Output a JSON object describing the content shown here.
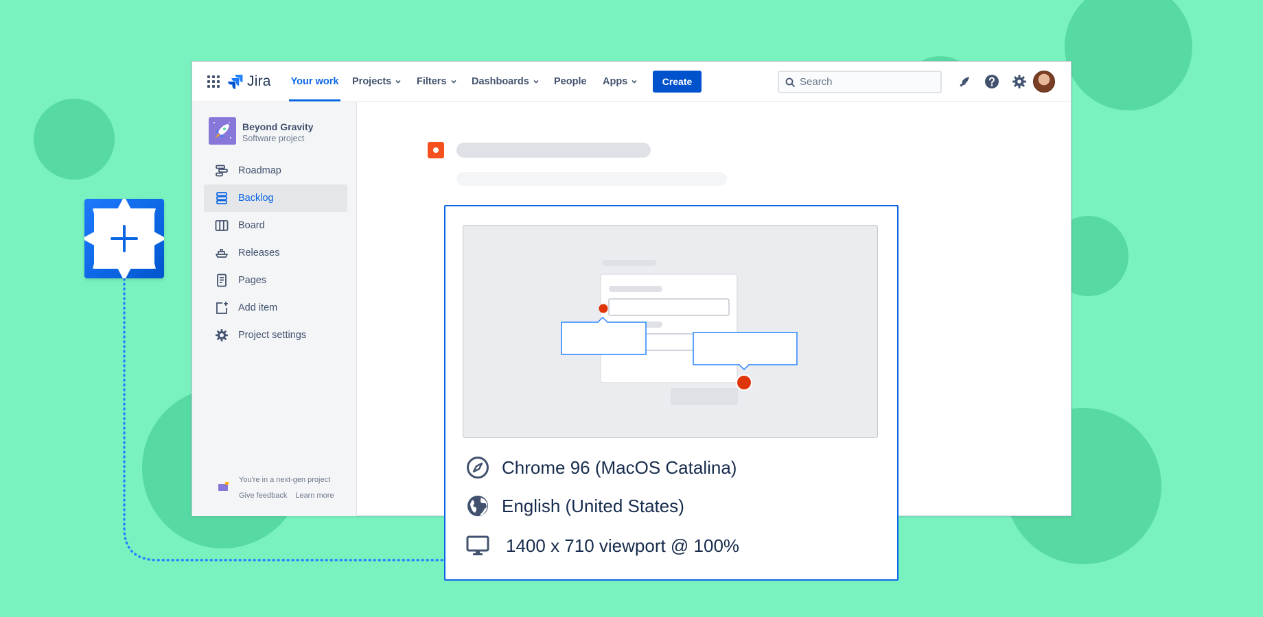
{
  "nav": {
    "logo_text": "Jira",
    "items": [
      {
        "label": "Your work"
      },
      {
        "label": "Projects"
      },
      {
        "label": "Filters"
      },
      {
        "label": "Dashboards"
      },
      {
        "label": "People"
      },
      {
        "label": "Apps"
      }
    ],
    "create_label": "Create",
    "search_placeholder": "Search"
  },
  "sidebar": {
    "project_name": "Beyond Gravity",
    "project_type": "Software project",
    "items": [
      {
        "label": "Roadmap",
        "icon": "roadmap-icon"
      },
      {
        "label": "Backlog",
        "icon": "backlog-icon",
        "active": true
      },
      {
        "label": "Board",
        "icon": "board-icon"
      },
      {
        "label": "Releases",
        "icon": "releases-icon"
      },
      {
        "label": "Pages",
        "icon": "pages-icon"
      },
      {
        "label": "Add item",
        "icon": "add-item-icon"
      },
      {
        "label": "Project settings",
        "icon": "gear-icon"
      }
    ],
    "footer_note": "You're in a next-gen project",
    "footer_links": [
      "Give feedback",
      "Learn more"
    ]
  },
  "card": {
    "browser": "Chrome 96 (MacOS Catalina)",
    "language": "English (United States)",
    "viewport": "1400 x 710 viewport @ 100%"
  },
  "colors": {
    "background": "#79F2C0",
    "blob": "#57D9A3",
    "accent": "#0C66E4",
    "create_button": "#0052CC",
    "issue_icon": "#F4511E",
    "marker": "#DE350B"
  }
}
